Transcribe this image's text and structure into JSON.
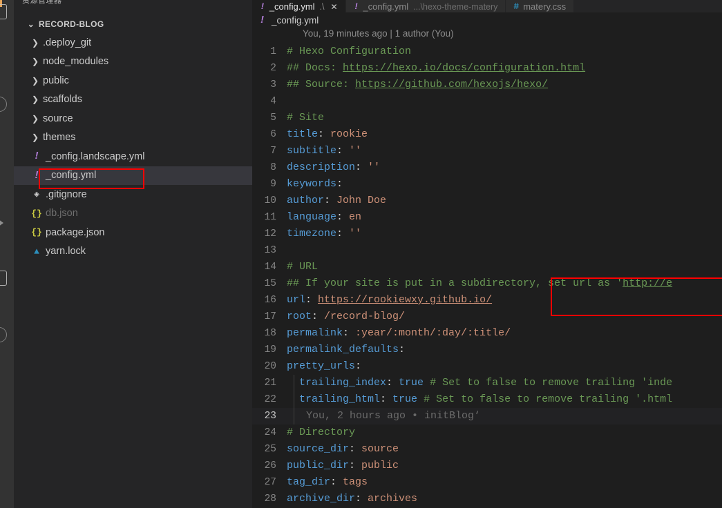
{
  "activity_bar": {
    "icons": [
      "explorer-icon",
      "search-icon",
      "source-control-icon",
      "run-debug-icon",
      "extensions-icon"
    ]
  },
  "sidebar": {
    "title": "资源管理器",
    "more_label": "···",
    "root": {
      "label": "RECORD-BLOG",
      "chevron": "⌄"
    },
    "items": [
      {
        "label": ".deploy_git",
        "type": "folder",
        "chevron": "❯",
        "icon": "chevron-right-icon",
        "dim": false
      },
      {
        "label": "node_modules",
        "type": "folder",
        "chevron": "❯",
        "icon": "chevron-right-icon",
        "dim": false
      },
      {
        "label": "public",
        "type": "folder",
        "chevron": "❯",
        "icon": "chevron-right-icon",
        "dim": false
      },
      {
        "label": "scaffolds",
        "type": "folder",
        "chevron": "❯",
        "icon": "chevron-right-icon",
        "dim": false
      },
      {
        "label": "source",
        "type": "folder",
        "chevron": "❯",
        "icon": "chevron-right-icon",
        "dim": false
      },
      {
        "label": "themes",
        "type": "folder",
        "chevron": "❯",
        "icon": "chevron-right-icon",
        "dim": false
      },
      {
        "label": "_config.landscape.yml",
        "type": "file",
        "icon": "yaml-file-icon",
        "glyph": "!",
        "dim": false
      },
      {
        "label": "_config.yml",
        "type": "file",
        "icon": "yaml-file-icon",
        "glyph": "!",
        "dim": false,
        "selected": true
      },
      {
        "label": ".gitignore",
        "type": "file",
        "icon": "git-file-icon",
        "glyph": "◈",
        "dim": false
      },
      {
        "label": "db.json",
        "type": "file",
        "icon": "json-file-icon",
        "glyph": "{}",
        "dim": true
      },
      {
        "label": "package.json",
        "type": "file",
        "icon": "json-file-icon",
        "glyph": "{}",
        "dim": false
      },
      {
        "label": "yarn.lock",
        "type": "file",
        "icon": "yarn-file-icon",
        "glyph": "▲",
        "dim": false
      }
    ]
  },
  "tabs": [
    {
      "name": "_config.yml",
      "desc": ".\\",
      "glyph": "!",
      "icon": "yaml-file-icon",
      "active": true,
      "close": "✕"
    },
    {
      "name": "_config.yml",
      "desc": "...\\hexo-theme-matery",
      "glyph": "!",
      "icon": "yaml-file-icon",
      "active": false,
      "close": ""
    },
    {
      "name": "matery.css",
      "desc": "",
      "glyph": "#",
      "icon": "css-file-icon",
      "active": false,
      "close": ""
    }
  ],
  "breadcrumb": {
    "glyph": "!",
    "label": "_config.yml"
  },
  "blame_header": "You, 19 minutes ago | 1 author (You)",
  "annotations": {
    "sidebar_box_target": "_config.yml",
    "code_box_target": "lines 15-16 url setting",
    "color": "#fe0000"
  },
  "code": {
    "language": "yaml",
    "cursor_line": 23,
    "inline_blame": "You, 2 hours ago • initBlog‘",
    "lines": [
      {
        "n": 1,
        "tokens": [
          {
            "t": "# Hexo Configuration",
            "c": "t-com"
          }
        ]
      },
      {
        "n": 2,
        "tokens": [
          {
            "t": "## Docs: ",
            "c": "t-com"
          },
          {
            "t": "https://hexo.io/docs/configuration.html",
            "c": "t-link"
          }
        ]
      },
      {
        "n": 3,
        "tokens": [
          {
            "t": "## Source: ",
            "c": "t-com"
          },
          {
            "t": "https://github.com/hexojs/hexo/",
            "c": "t-link"
          }
        ]
      },
      {
        "n": 4,
        "tokens": []
      },
      {
        "n": 5,
        "tokens": [
          {
            "t": "# Site",
            "c": "t-com"
          }
        ]
      },
      {
        "n": 6,
        "tokens": [
          {
            "t": "title",
            "c": "t-key"
          },
          {
            "t": ": ",
            "c": "t-punc"
          },
          {
            "t": "rookie",
            "c": "t-str"
          }
        ]
      },
      {
        "n": 7,
        "tokens": [
          {
            "t": "subtitle",
            "c": "t-key"
          },
          {
            "t": ": ",
            "c": "t-punc"
          },
          {
            "t": "''",
            "c": "t-str"
          }
        ]
      },
      {
        "n": 8,
        "tokens": [
          {
            "t": "description",
            "c": "t-key"
          },
          {
            "t": ": ",
            "c": "t-punc"
          },
          {
            "t": "''",
            "c": "t-str"
          }
        ]
      },
      {
        "n": 9,
        "tokens": [
          {
            "t": "keywords",
            "c": "t-key"
          },
          {
            "t": ":",
            "c": "t-punc"
          }
        ]
      },
      {
        "n": 10,
        "tokens": [
          {
            "t": "author",
            "c": "t-key"
          },
          {
            "t": ": ",
            "c": "t-punc"
          },
          {
            "t": "John Doe",
            "c": "t-str"
          }
        ]
      },
      {
        "n": 11,
        "tokens": [
          {
            "t": "language",
            "c": "t-key"
          },
          {
            "t": ": ",
            "c": "t-punc"
          },
          {
            "t": "en",
            "c": "t-str"
          }
        ]
      },
      {
        "n": 12,
        "tokens": [
          {
            "t": "timezone",
            "c": "t-key"
          },
          {
            "t": ": ",
            "c": "t-punc"
          },
          {
            "t": "''",
            "c": "t-str"
          }
        ]
      },
      {
        "n": 13,
        "tokens": []
      },
      {
        "n": 14,
        "tokens": [
          {
            "t": "# URL",
            "c": "t-com"
          }
        ]
      },
      {
        "n": 15,
        "tokens": [
          {
            "t": "## If your site is put in a subdirectory, set url as '",
            "c": "t-com"
          },
          {
            "t": "http://e",
            "c": "t-link"
          }
        ]
      },
      {
        "n": 16,
        "tokens": [
          {
            "t": "url",
            "c": "t-key"
          },
          {
            "t": ": ",
            "c": "t-punc"
          },
          {
            "t": "https://rookiewxy.github.io/",
            "c": "t-strlink"
          }
        ]
      },
      {
        "n": 17,
        "tokens": [
          {
            "t": "root",
            "c": "t-key"
          },
          {
            "t": ": ",
            "c": "t-punc"
          },
          {
            "t": "/record-blog/",
            "c": "t-str"
          }
        ]
      },
      {
        "n": 18,
        "tokens": [
          {
            "t": "permalink",
            "c": "t-key"
          },
          {
            "t": ": ",
            "c": "t-punc"
          },
          {
            "t": ":year/:month/:day/:title/",
            "c": "t-str"
          }
        ]
      },
      {
        "n": 19,
        "tokens": [
          {
            "t": "permalink_defaults",
            "c": "t-key"
          },
          {
            "t": ":",
            "c": "t-punc"
          }
        ]
      },
      {
        "n": 20,
        "tokens": [
          {
            "t": "pretty_urls",
            "c": "t-key"
          },
          {
            "t": ":",
            "c": "t-punc"
          }
        ]
      },
      {
        "n": 21,
        "indent": true,
        "tokens": [
          {
            "t": "  trailing_index",
            "c": "t-key"
          },
          {
            "t": ": ",
            "c": "t-punc"
          },
          {
            "t": "true",
            "c": "t-kw"
          },
          {
            "t": " # Set to false to remove trailing 'inde",
            "c": "t-com"
          }
        ]
      },
      {
        "n": 22,
        "indent": true,
        "tokens": [
          {
            "t": "  trailing_html",
            "c": "t-key"
          },
          {
            "t": ": ",
            "c": "t-punc"
          },
          {
            "t": "true",
            "c": "t-kw"
          },
          {
            "t": " # Set to false to remove trailing '.html",
            "c": "t-com"
          }
        ]
      },
      {
        "n": 23,
        "indent": true,
        "cursor": true,
        "tokens": [],
        "blame": "You, 2 hours ago • initBlog‘"
      },
      {
        "n": 24,
        "tokens": [
          {
            "t": "# Directory",
            "c": "t-com"
          }
        ]
      },
      {
        "n": 25,
        "tokens": [
          {
            "t": "source_dir",
            "c": "t-key"
          },
          {
            "t": ": ",
            "c": "t-punc"
          },
          {
            "t": "source",
            "c": "t-str"
          }
        ]
      },
      {
        "n": 26,
        "tokens": [
          {
            "t": "public_dir",
            "c": "t-key"
          },
          {
            "t": ": ",
            "c": "t-punc"
          },
          {
            "t": "public",
            "c": "t-str"
          }
        ]
      },
      {
        "n": 27,
        "tokens": [
          {
            "t": "tag_dir",
            "c": "t-key"
          },
          {
            "t": ": ",
            "c": "t-punc"
          },
          {
            "t": "tags",
            "c": "t-str"
          }
        ]
      },
      {
        "n": 28,
        "tokens": [
          {
            "t": "archive_dir",
            "c": "t-key"
          },
          {
            "t": ": ",
            "c": "t-punc"
          },
          {
            "t": "archives",
            "c": "t-str"
          }
        ]
      }
    ]
  }
}
